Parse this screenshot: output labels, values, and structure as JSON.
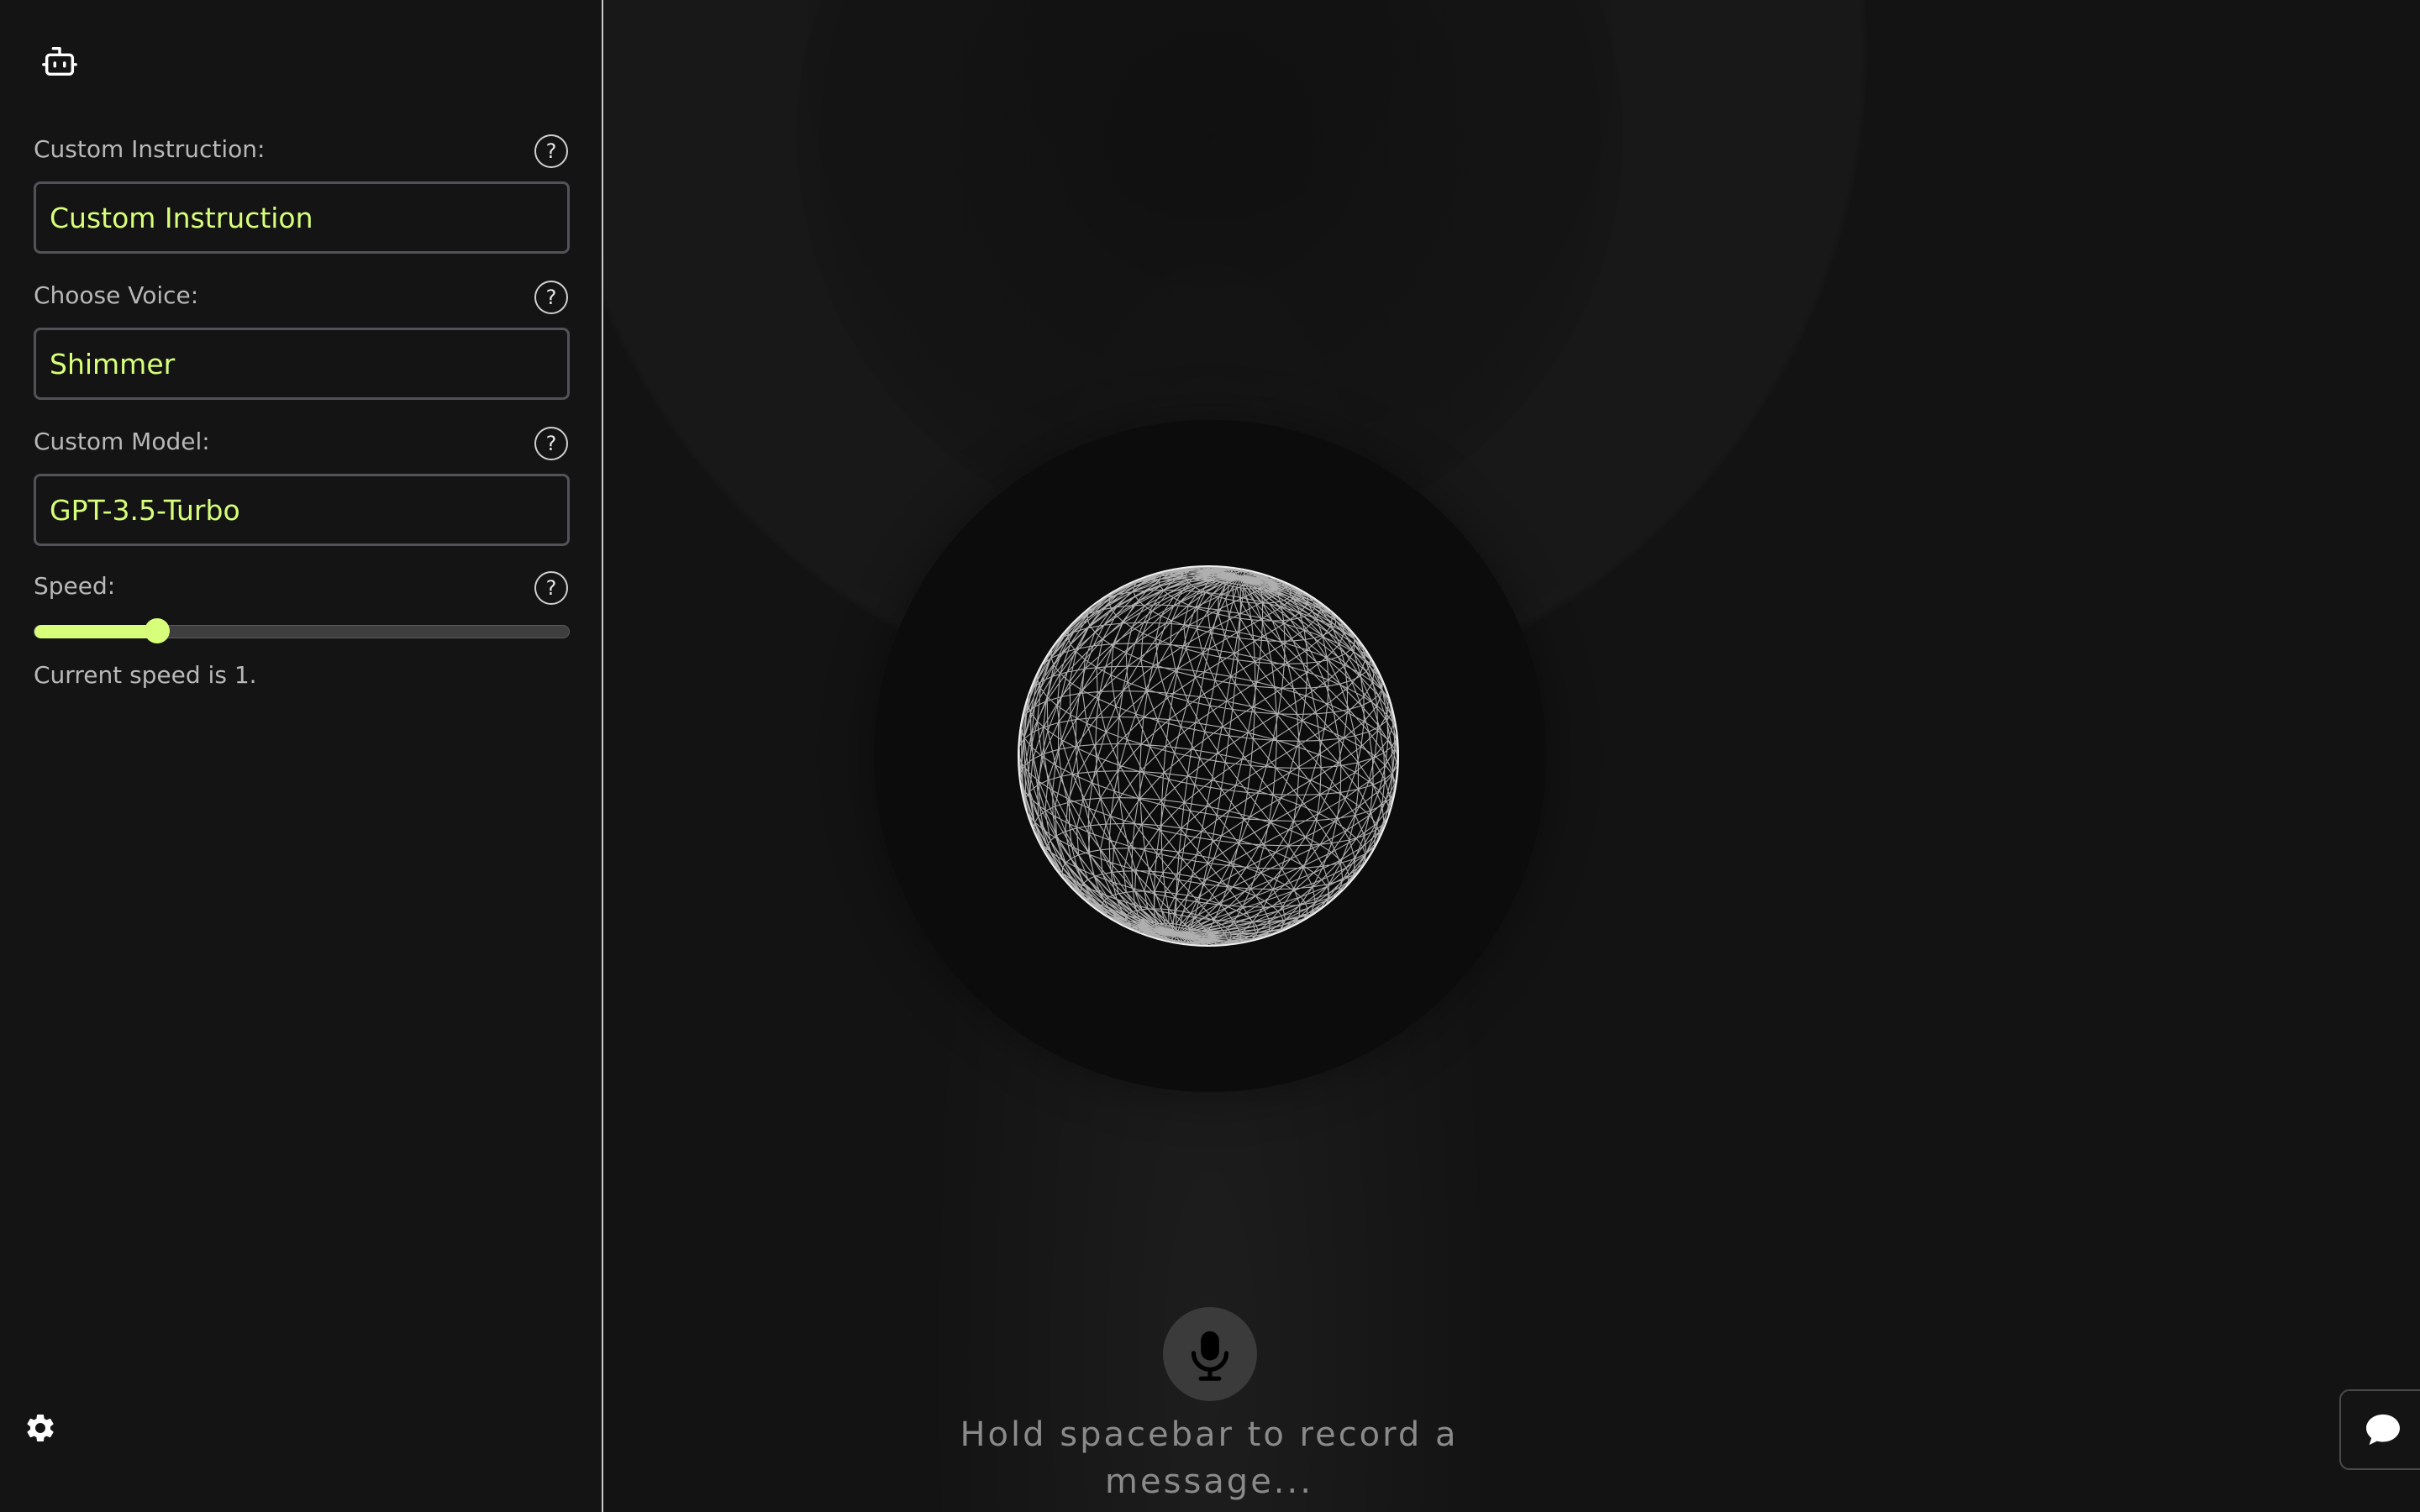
{
  "sidebar": {
    "fields": [
      {
        "label": "Custom Instruction:",
        "value": "Custom Instruction",
        "help": "?"
      },
      {
        "label": "Choose Voice:",
        "value": "Shimmer",
        "help": "?"
      },
      {
        "label": "Custom Model:",
        "value": "GPT-3.5-Turbo",
        "help": "?"
      }
    ],
    "speed": {
      "label": "Speed:",
      "help": "?",
      "value": 1,
      "fill_fraction": 0.23,
      "status_text": "Current speed is 1."
    }
  },
  "main": {
    "record_hint": "Hold spacebar to record a message..."
  },
  "icons": {
    "bot": "bot-icon",
    "settings": "gear-icon",
    "microphone": "microphone-icon",
    "chat": "chat-bubble-icon",
    "help": "help-icon"
  },
  "colors": {
    "accent": "#d7ff7a",
    "background": "#131313",
    "sidebar": "#141414"
  }
}
